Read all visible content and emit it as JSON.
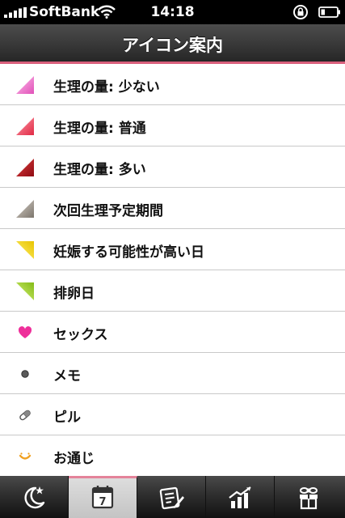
{
  "status_bar": {
    "carrier": "SoftBank",
    "time": "14:18"
  },
  "navbar": {
    "title": "アイコン案内"
  },
  "items": [
    {
      "label": "生理の量: 少ない",
      "icon": "pink-triangle-icon",
      "color": "#f07ad0"
    },
    {
      "label": "生理の量: 普通",
      "icon": "red-triangle-icon",
      "color": "#ee3a55"
    },
    {
      "label": "生理の量: 多い",
      "icon": "dark-red-triangle-icon",
      "color": "#b3121d"
    },
    {
      "label": "次回生理予定期間",
      "icon": "gray-triangle-icon",
      "color": "#9a9288"
    },
    {
      "label": "妊娠する可能性が高い日",
      "icon": "yellow-triangle-icon",
      "color": "#f7dc1e"
    },
    {
      "label": "排卵日",
      "icon": "green-triangle-icon",
      "color": "#9ccf2a"
    },
    {
      "label": "セックス",
      "icon": "heart-icon",
      "color": "#ee2f9a"
    },
    {
      "label": "メモ",
      "icon": "memo-dot-icon",
      "color": "#555555"
    },
    {
      "label": "ピル",
      "icon": "pill-icon",
      "color": "#666666"
    },
    {
      "label": "お通じ",
      "icon": "smile-icon",
      "color": "#f0a020"
    }
  ],
  "tab_bar": {
    "selected_index": 1,
    "tabs": [
      {
        "icon": "moon-star-icon"
      },
      {
        "icon": "calendar-icon",
        "calendar_day": "7"
      },
      {
        "icon": "notepad-icon"
      },
      {
        "icon": "chart-icon"
      },
      {
        "icon": "gift-flower-icon"
      }
    ]
  },
  "colors": {
    "accent": "#d9607c"
  }
}
